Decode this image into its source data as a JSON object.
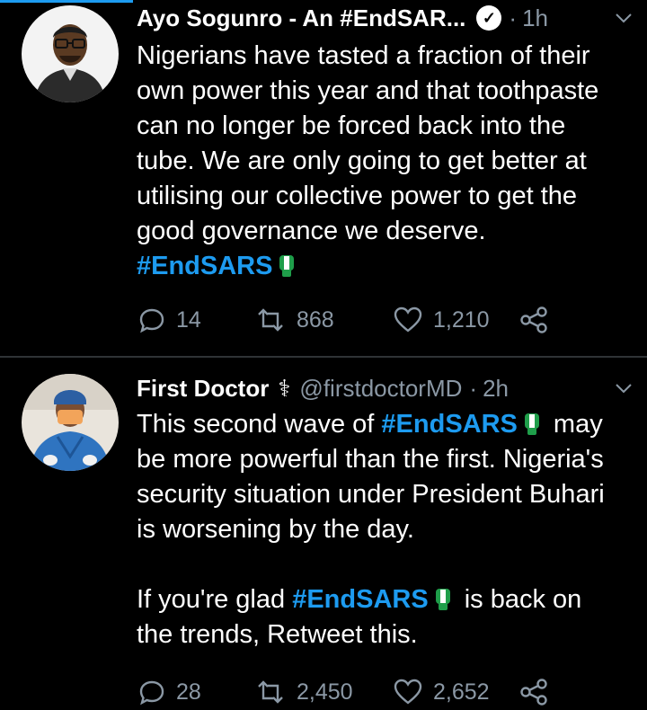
{
  "tweets": [
    {
      "author_name": "Ayo Sogunro - An #EndSAR...",
      "verified": true,
      "separator": "·",
      "time": "1h",
      "body_lines": [
        "Nigerians have tasted a fraction of their",
        "own power this year and that toothpaste",
        "can no longer be forced back into the",
        "tube. We are only going to get better at",
        "utilising our collective power to get the",
        "good governance we deserve."
      ],
      "hashtag": "#EndSARS",
      "replies": "14",
      "retweets": "868",
      "likes": "1,210"
    },
    {
      "author_name": "First Doctor",
      "name_emoji": "⚕",
      "handle": "@firstdoctorMD",
      "separator": "·",
      "time": "2h",
      "line1_pre": "This second wave of ",
      "hashtag": "#EndSARS",
      "line1_post": "may",
      "body_lines": [
        "be more powerful than the first. Nigeria's",
        "security situation under President Buhari",
        "is worsening by the day."
      ],
      "para2_pre": "If you're glad ",
      "para2_post": "is back on",
      "para2_line2": "the trends, Retweet this.",
      "replies": "28",
      "retweets": "2,450",
      "likes": "2,652"
    }
  ],
  "colors": {
    "accent": "#1d9bf0",
    "muted": "#8b98a5",
    "background": "#000000"
  },
  "icons": [
    "reply-icon",
    "retweet-icon",
    "like-icon",
    "share-icon",
    "chevron-down-icon",
    "verified-badge-icon",
    "raised-fist-icon"
  ]
}
